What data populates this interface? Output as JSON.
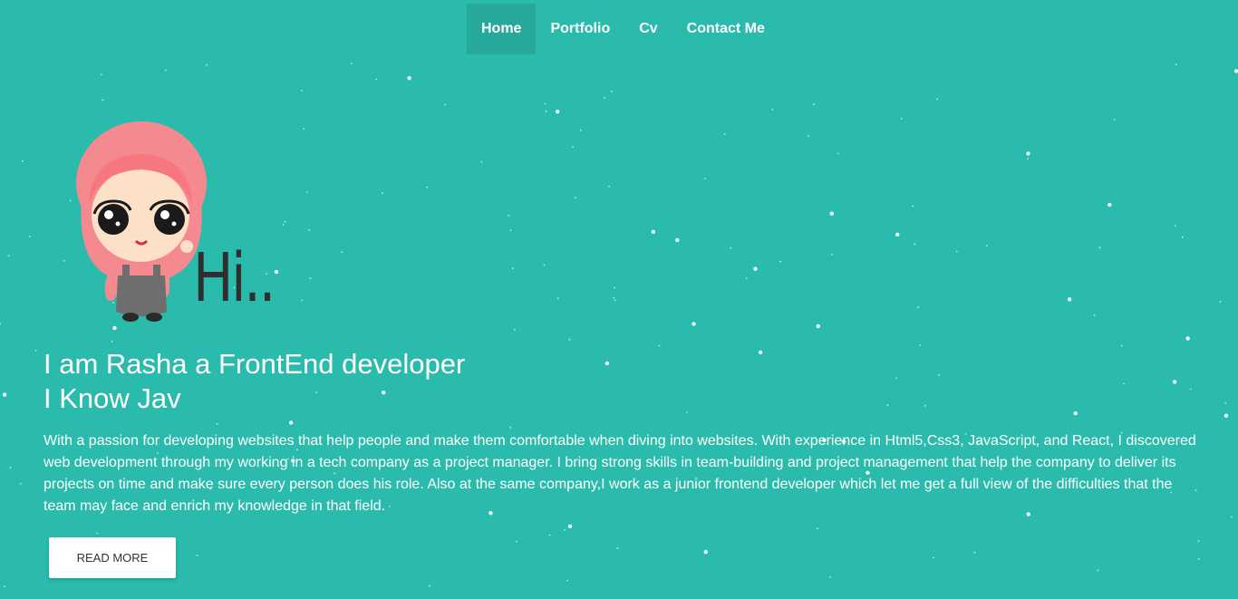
{
  "nav": {
    "items": [
      {
        "label": "Home",
        "active": true
      },
      {
        "label": "Portfolio",
        "active": false
      },
      {
        "label": "Cv",
        "active": false
      },
      {
        "label": "Contact Me",
        "active": false
      }
    ]
  },
  "hero": {
    "greeting": "Hi..",
    "headline_line1": "I am Rasha a FrontEnd developer",
    "headline_line2": "I Know Jav",
    "bio": "With a passion for developing websites that help people and make them comfortable when diving into websites. With experience in Html5,Css3, JavaScript, and React, I discovered web development through my working in a tech company as a project manager. I bring strong skills in team-building and project management that help the company to deliver its projects on time and make sure every person does his role. Also at the same company,I work as a junior frontend developer which let me get a full view of the difficulties that the team may face and enrich my knowledge in that field.",
    "read_more_label": "READ MORE"
  },
  "colors": {
    "background": "#2bbbad",
    "hijab": "#f48a8f",
    "skin": "#fde0c8",
    "overalls": "#6e6e6e"
  }
}
